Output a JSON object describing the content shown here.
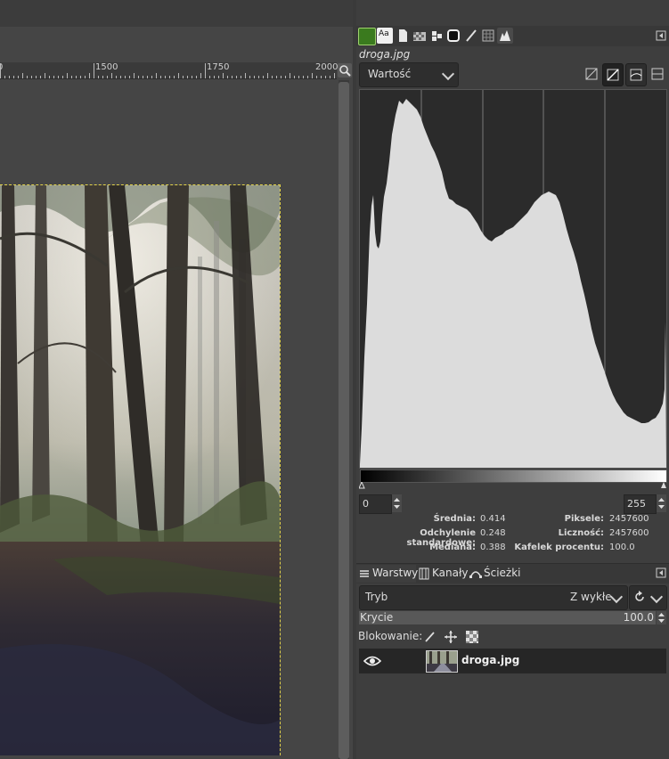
{
  "ruler": {
    "labels": [
      "0",
      "1500",
      "1750",
      "2000"
    ]
  },
  "dock": {
    "tabs": [
      "brushes-icon",
      "fonts-icon",
      "document-icon",
      "pattern-icon",
      "palette-icon",
      "gradient-icon",
      "pencil-icon",
      "grid-icon",
      "histogram-icon"
    ]
  },
  "histogram": {
    "title": "droga.jpg",
    "channel": "Wartość",
    "range_low": "0",
    "range_high": "255",
    "stats_left": [
      {
        "label": "Średnia:",
        "value": "0.414"
      },
      {
        "label": "Odchylenie standardowe:",
        "value": "0.248"
      },
      {
        "label": "Mediana:",
        "value": "0.388"
      }
    ],
    "stats_right": [
      {
        "label": "Piksele:",
        "value": "2457600"
      },
      {
        "label": "Liczność:",
        "value": "2457600"
      },
      {
        "label": "Kafelek procentu:",
        "value": "100.0"
      }
    ]
  },
  "layers": {
    "tabs": [
      "Warstwy",
      "Kanały",
      "Ścieżki"
    ],
    "mode_label": "Tryb",
    "mode_value": "Z wykłe",
    "opacity_label": "Krycie",
    "opacity_value": "100.0",
    "lock_label": "Blokowanie:",
    "items": [
      {
        "name": "droga.jpg"
      }
    ]
  },
  "colors": {
    "accent_selection": "#e3d34a",
    "panel": "#3e3e3e",
    "histogram_fill": "#dcdcdc"
  }
}
